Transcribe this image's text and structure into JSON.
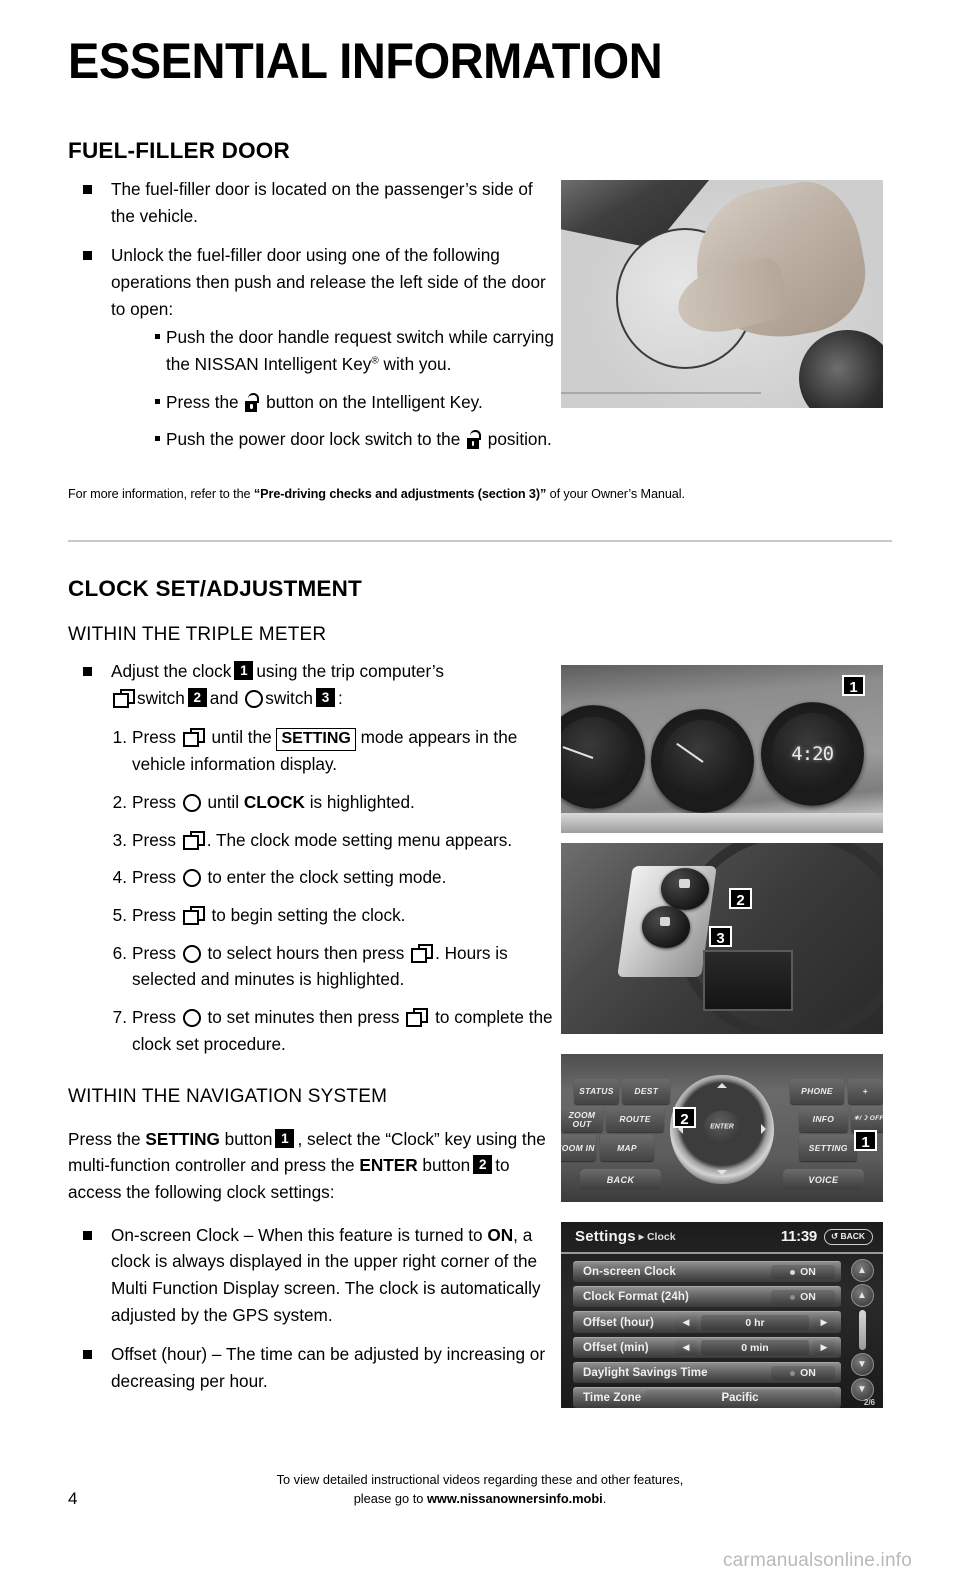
{
  "page_title": "ESSENTIAL INFORMATION",
  "page_number": "4",
  "watermark": "carmanualsonline.info",
  "section_fuel": {
    "heading": "FUEL-FILLER DOOR",
    "bullet1": "The fuel-filler door is located on the passenger’s side of the vehicle.",
    "bullet2": "Unlock the fuel-filler door using one of the following operations then push and release the left side of the door to open:",
    "sub1_a": "Push the door handle request switch while carrying the NISSAN Intelligent Key",
    "sub1_reg": "®",
    "sub1_b": " with you.",
    "sub2_a": "Press the ",
    "sub2_b": " button on the Intelligent Key.",
    "sub3_a": "Push the power door lock switch to the ",
    "sub3_b": " position.",
    "footnote_a": "For more information, refer to the ",
    "footnote_bold": "“Pre-driving checks and adjustments (section 3)”",
    "footnote_b": " of your Owner’s Manual."
  },
  "section_clock": {
    "heading": "CLOCK SET/ADJUSTMENT",
    "sub_triple": "WITHIN THE TRIPLE METER",
    "adjust_a": "Adjust the clock",
    "adjust_callout1": "1",
    "adjust_b": "using the trip computer’s",
    "adjust_c": "switch",
    "adjust_callout2": "2",
    "adjust_d": "and",
    "adjust_e": "switch",
    "adjust_callout3": "3",
    "adjust_f": ":",
    "steps": [
      {
        "n": "1.",
        "a": "Press",
        "icon1": "double-square-switch-icon",
        "b": "until the",
        "boxed": "SETTING",
        "c": "mode appears in the vehicle information display."
      },
      {
        "n": "2.",
        "a": "Press",
        "icon1": "circle-switch-icon",
        "b": "until",
        "bold": "CLOCK",
        "c": "is highlighted."
      },
      {
        "n": "3.",
        "a": "Press",
        "icon1": "double-square-switch-icon",
        "c": ". The clock mode setting menu appears."
      },
      {
        "n": "4.",
        "a": "Press",
        "icon1": "circle-switch-icon",
        "c": "to enter the clock setting mode."
      },
      {
        "n": "5.",
        "a": "Press",
        "icon1": "double-square-switch-icon",
        "c": "to begin setting the clock."
      },
      {
        "n": "6.",
        "a": "Press",
        "icon1": "circle-switch-icon",
        "b": "to select hours then press",
        "icon2": "double-square-switch-icon",
        "c": ". Hours is selected and minutes is highlighted."
      },
      {
        "n": "7.",
        "a": "Press",
        "icon1": "circle-switch-icon",
        "b": "to set minutes then press",
        "icon2": "double-square-switch-icon",
        "c": "to complete the clock set procedure."
      }
    ],
    "sub_nav": "WITHIN THE NAVIGATION SYSTEM",
    "nav_para_a": "Press the ",
    "nav_para_setting": "SETTING",
    "nav_para_b": " button",
    "nav_callout1": "1",
    "nav_para_c": ", select the “Clock” key using the multi-function controller and press the ",
    "nav_para_enter": "ENTER",
    "nav_para_d": " button",
    "nav_callout2": "2",
    "nav_para_e": "to access the following clock settings:",
    "bullet_onscreen_a": "On-screen Clock – When this feature is turned to ",
    "bullet_onscreen_bold": "ON",
    "bullet_onscreen_b": ", a clock is always displayed in the upper right corner of the Multi Function Display screen. The clock is automatically adjusted by the GPS system.",
    "bullet_offset": "Offset (hour) – The time can be adjusted by increasing or decreasing per hour."
  },
  "photos": {
    "fuel_door": {
      "callout": ""
    },
    "triple_meter": {
      "callout": "1",
      "clock_value": "4:20"
    },
    "trip_switch": {
      "callout_a": "2",
      "callout_b": "3"
    },
    "controller": {
      "callout_a": "2",
      "callout_b": "1",
      "buttons_left": [
        "STATUS",
        "DEST",
        "ZOOM OUT",
        "ROUTE",
        "ZOOM IN",
        "MAP"
      ],
      "buttons_right": [
        "PHONE",
        "+",
        "INFO",
        "☀/☽ OFF",
        "SETTING"
      ],
      "enter_label": "ENTER",
      "back_label": "BACK",
      "voice_label": "VOICE"
    },
    "nav_screen": {
      "title": "Settings",
      "breadcrumb": "▸ Clock",
      "time": "11:39",
      "back_label": "BACK",
      "page_indicator": "2/6",
      "rows": [
        {
          "label": "On-screen Clock",
          "type": "toggle",
          "value": "ON",
          "state": "on"
        },
        {
          "label": "Clock Format (24h)",
          "type": "toggle",
          "value": "ON",
          "state": "dim"
        },
        {
          "label": "Offset (hour)",
          "type": "stepper",
          "value": "0 hr"
        },
        {
          "label": "Offset (min)",
          "type": "stepper",
          "value": "0 min"
        },
        {
          "label": "Daylight Savings Time",
          "type": "toggle",
          "value": "ON",
          "state": "dim"
        },
        {
          "label": "Time Zone",
          "type": "value",
          "value": "Pacific"
        }
      ]
    }
  },
  "footer": {
    "line1": "To view detailed instructional videos regarding these and other features,",
    "line2_a": "please go to ",
    "line2_bold": "www.nissanownersinfo.mobi",
    "line2_b": "."
  }
}
